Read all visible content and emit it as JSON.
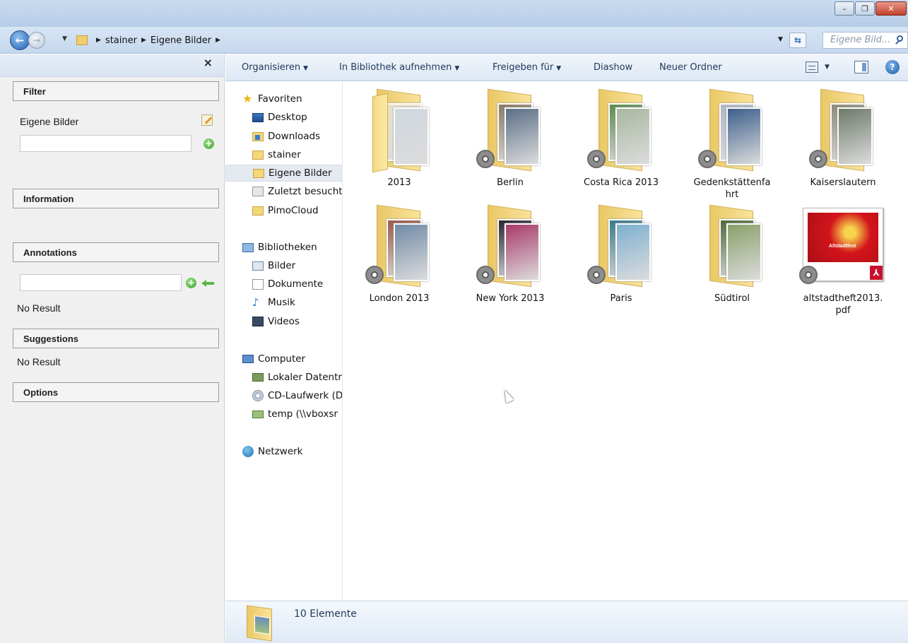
{
  "window": {
    "controls": {
      "minimize": "–",
      "maximize": "❐",
      "close": "✕"
    }
  },
  "addressbar": {
    "breadcrumb": [
      "stainer",
      "Eigene Bilder"
    ],
    "search_placeholder": "Eigene Bild..."
  },
  "left_panel": {
    "close_label": "×",
    "sections": {
      "filter": "Filter",
      "information": "Information",
      "annotations": "Annotations",
      "suggestions": "Suggestions",
      "options": "Options"
    },
    "filter_label": "Eigene Bilder",
    "annotations_result": "No Result",
    "suggestions_result": "No Result"
  },
  "toolbar": {
    "organize": "Organisieren",
    "include_library": "In Bibliothek aufnehmen",
    "share_with": "Freigeben für",
    "slideshow": "Diashow",
    "new_folder": "Neuer Ordner",
    "help": "?"
  },
  "nav_pane": {
    "favorites": {
      "label": "Favoriten",
      "items": [
        "Desktop",
        "Downloads",
        "stainer",
        "Eigene Bilder",
        "Zuletzt besucht",
        "PimoCloud"
      ]
    },
    "libraries": {
      "label": "Bibliotheken",
      "items": [
        "Bilder",
        "Dokumente",
        "Musik",
        "Videos"
      ]
    },
    "computer": {
      "label": "Computer",
      "items": [
        "Lokaler Datentr",
        "CD-Laufwerk (D",
        "temp (\\\\vboxsr"
      ]
    },
    "network": {
      "label": "Netzwerk"
    },
    "selected": "Eigene Bilder"
  },
  "content": {
    "items": [
      {
        "name": "2013",
        "type": "folder",
        "synced": false,
        "colors": [
          "#e8e0c8",
          "#cfd7df"
        ]
      },
      {
        "name": "Berlin",
        "type": "folder",
        "synced": true,
        "colors": [
          "#8a7a66",
          "#5b6f86"
        ]
      },
      {
        "name": "Costa Rica 2013",
        "type": "folder",
        "synced": true,
        "colors": [
          "#5d8a4e",
          "#a8b7a0"
        ]
      },
      {
        "name": "Gedenkstättenfahrt",
        "type": "folder",
        "synced": true,
        "colors": [
          "#b0b8c4",
          "#3d5f8c"
        ]
      },
      {
        "name": "Kaiserslautern",
        "type": "folder",
        "synced": true,
        "colors": [
          "#8d8a7d",
          "#6d7a6a"
        ]
      },
      {
        "name": "London 2013",
        "type": "folder",
        "synced": true,
        "colors": [
          "#9a5a4a",
          "#6f8aa6"
        ]
      },
      {
        "name": "New York 2013",
        "type": "folder",
        "synced": true,
        "colors": [
          "#2a2430",
          "#a83a6a"
        ]
      },
      {
        "name": "Paris",
        "type": "folder",
        "synced": true,
        "colors": [
          "#3a7a8a",
          "#7eb0d0"
        ]
      },
      {
        "name": "Südtirol",
        "type": "folder",
        "synced": false,
        "colors": [
          "#4f6a3a",
          "#8aa06a"
        ]
      },
      {
        "name": "altstadtheft2013.pdf",
        "type": "pdf",
        "synced": true,
        "thumb_text": "Altstadtfest"
      }
    ]
  },
  "details": {
    "summary": "10 Elemente"
  }
}
